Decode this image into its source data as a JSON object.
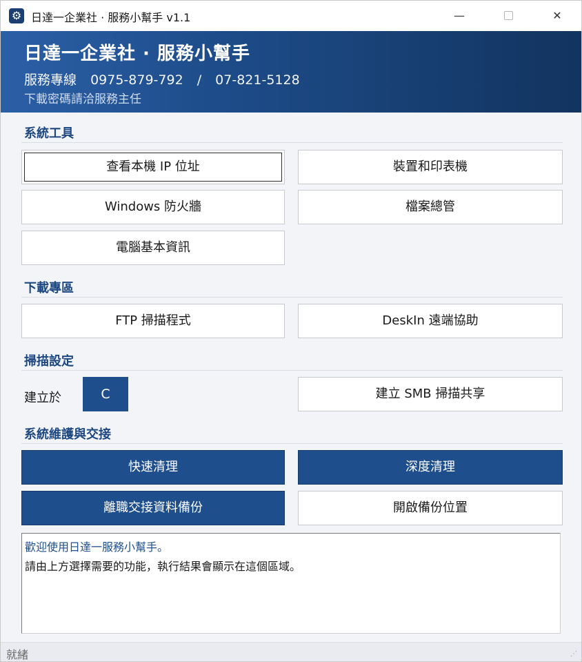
{
  "window": {
    "title": "日達一企業社 · 服務小幫手  v1.1",
    "app_icon": "gear-icon",
    "controls": {
      "minimize": "—",
      "maximize_icon": "square",
      "close": "✕"
    }
  },
  "header": {
    "title": "日達一企業社 · 服務小幫手",
    "phone_label": "服務專線",
    "phone_1": "0975-879-792",
    "separator": "/",
    "phone_2": "07-821-5128",
    "note": "下載密碼請洽服務主任"
  },
  "sections": {
    "system_tools": {
      "title": "系統工具",
      "buttons": [
        "查看本機 IP 位址",
        "裝置和印表機",
        "Windows 防火牆",
        "檔案總管",
        "電腦基本資訊"
      ]
    },
    "downloads": {
      "title": "下載專區",
      "buttons": [
        "FTP 掃描程式",
        "DeskIn 遠端協助"
      ]
    },
    "scan_settings": {
      "title": "掃描設定",
      "create_on_label": "建立於",
      "drive_value": "C",
      "smb_button": "建立 SMB 掃描共享"
    },
    "maintenance": {
      "title": "系統維護與交接",
      "buttons": [
        "快速清理",
        "深度清理",
        "離職交接資料備份",
        "開啟備份位置"
      ]
    }
  },
  "log": {
    "lines": [
      "歡迎使用日達一服務小幫手。",
      "請由上方選擇需要的功能，執行結果會顯示在這個區域。"
    ]
  },
  "status": {
    "text": "就緒"
  },
  "colors": {
    "accent": "#1e4e8c",
    "banner_start": "#2b5fa6",
    "banner_end": "#12345f",
    "section_title": "#1d4780"
  }
}
